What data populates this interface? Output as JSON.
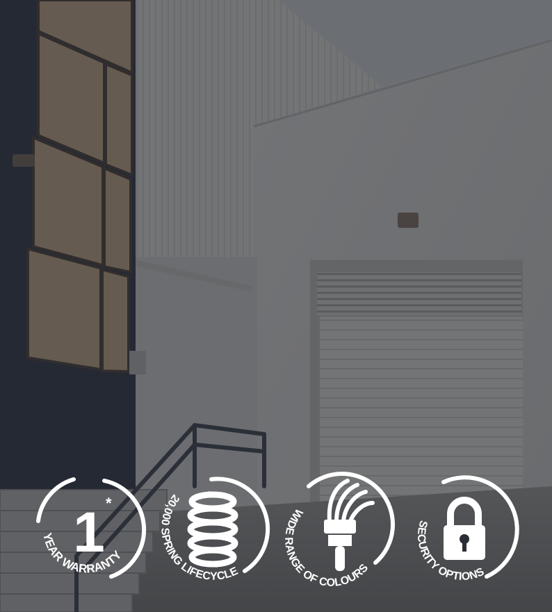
{
  "scene": {
    "subject": "commercial building exterior with white roller shutter door, staircase with railing, blue and tan cladding"
  },
  "badges": [
    {
      "icon": "number-one-icon",
      "number": "1",
      "asterisk": "*",
      "label": "YEAR WARRANTY"
    },
    {
      "icon": "spring-icon",
      "label": "20,000 SPRING LIFECYCLE"
    },
    {
      "icon": "paint-brush-icon",
      "label": "WIDE RANGE OF COLOURS"
    },
    {
      "icon": "padlock-icon",
      "label": "SECURITY OPTIONS"
    }
  ],
  "colors": {
    "text": "#ffffff",
    "overlay": "#2a2d33",
    "navy_wall": "#1b2436",
    "tan_panel": "#c7a57f",
    "white_wall": "#e6e4e0"
  }
}
